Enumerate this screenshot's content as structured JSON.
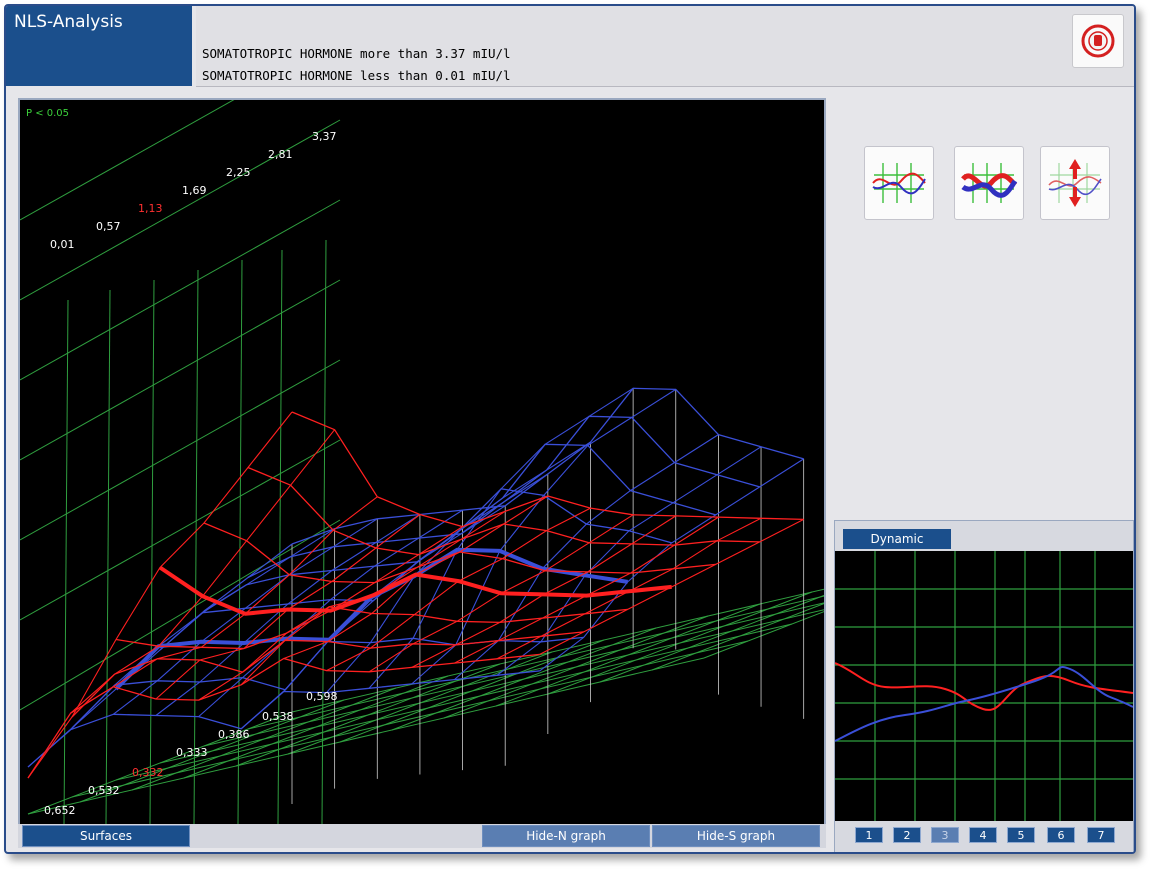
{
  "app": {
    "title": "NLS-Analysis"
  },
  "header": {
    "line1": "SOMATOTROPIC HORMONE more than 3.37 mIU/l",
    "line2": "SOMATOTROPIC HORMONE less than 0.01 mIU/l"
  },
  "graph": {
    "significance": "P < 0.05",
    "top_scale": [
      "0,01",
      "0,57",
      "1,13",
      "1,69",
      "2,25",
      "2,81",
      "3,37"
    ],
    "bottom_scale": [
      "0,652",
      "0,532",
      "0,332",
      "0,333",
      "0,386",
      "0,538",
      "0,598"
    ],
    "highlight_color": "#ff3030",
    "series_colors": {
      "s": "#ff2020",
      "n": "#3a4fd8"
    }
  },
  "buttons": {
    "surfaces": "Surfaces",
    "hide_n": "Hide-N graph",
    "hide_s": "Hide-S graph"
  },
  "tools": [
    "graph-compare-icon",
    "graph-bold-icon",
    "graph-arrows-icon"
  ],
  "dynamic": {
    "tab": "Dynamic",
    "pages": [
      "1",
      "2",
      "3",
      "4",
      "5",
      "6",
      "7"
    ],
    "active_page": "3"
  }
}
